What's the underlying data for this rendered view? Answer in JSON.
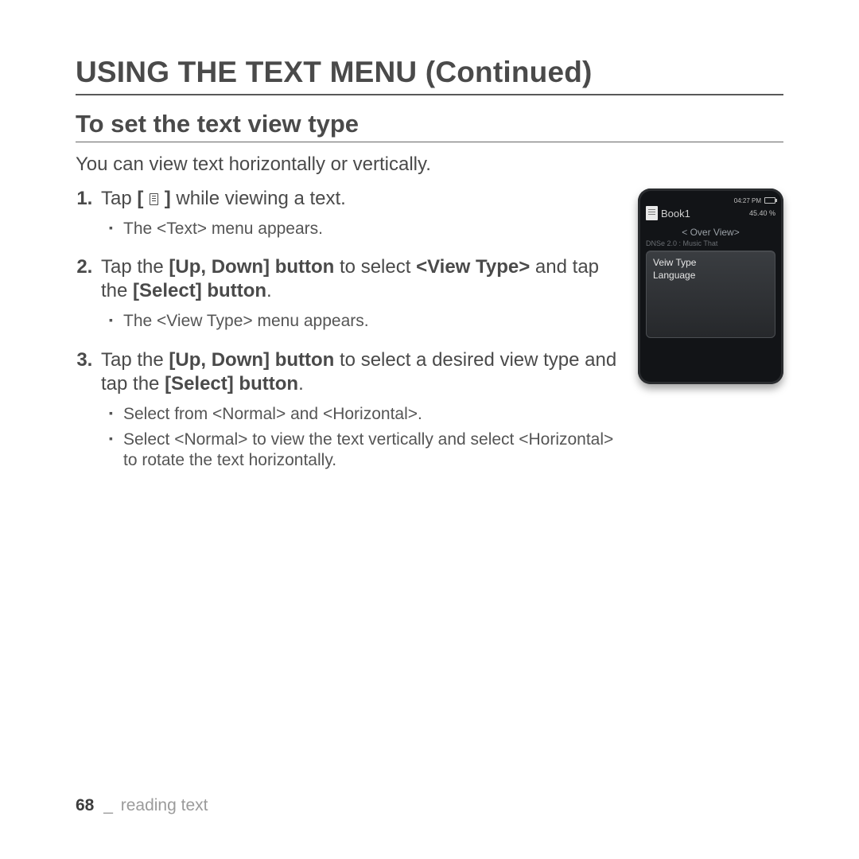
{
  "heading": "USING THE TEXT MENU (Continued)",
  "subheading": "To set the text view type",
  "intro": "You can view text horizontally or vertically.",
  "steps": {
    "s1": {
      "pre": "Tap ",
      "lbracket": "[ ",
      "rbracket": " ]",
      "post": " while viewing a text.",
      "sub1": "The <Text> menu appears."
    },
    "s2": {
      "t1": "Tap the ",
      "b1": "[Up, Down] button",
      "t2": " to select ",
      "b2": "<View Type>",
      "t3": " and tap the ",
      "b3": "[Select] button",
      "t4": ".",
      "sub1": "The <View Type> menu appears."
    },
    "s3": {
      "t1": "Tap the ",
      "b1": "[Up, Down] button",
      "t2": " to select a desired view type and tap the ",
      "b2": "[Select] button",
      "t3": ".",
      "sub1": "Select from <Normal> and <Horizontal>.",
      "sub2": "Select <Normal> to view the text vertically and select <Horizontal> to rotate the text horizontally."
    }
  },
  "device": {
    "time": "04:27 PM",
    "title": "Book1",
    "percent": "45.40 %",
    "overview": "< Over View>",
    "faint": "DNSe 2.0 : Music That",
    "menu": {
      "item1": "Veiw Type",
      "item2": "Language"
    }
  },
  "footer": {
    "page": "68",
    "sep": "_",
    "section": "reading text"
  }
}
